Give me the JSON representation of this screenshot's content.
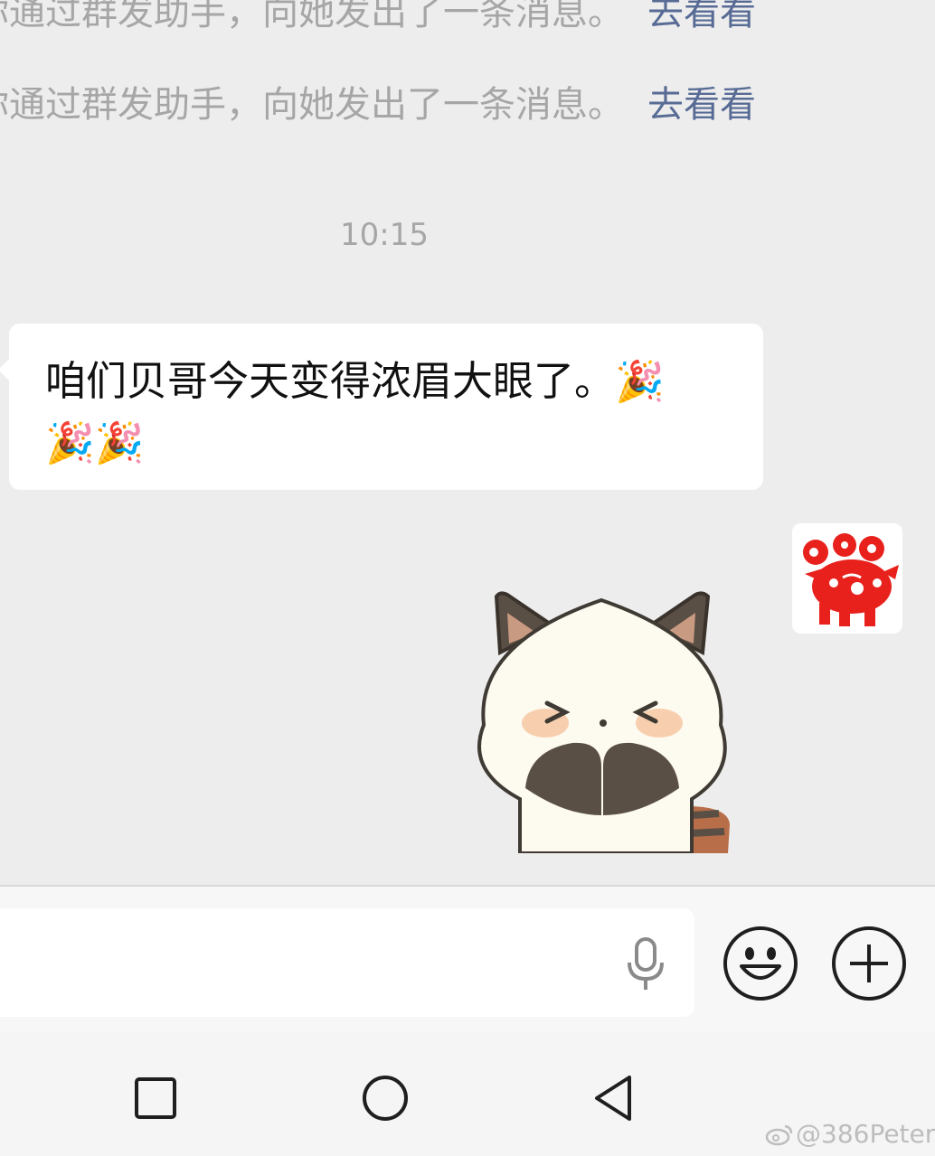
{
  "system_messages": [
    {
      "text": "你通过群发助手，向她发出了一条消息。",
      "link": "去看看"
    },
    {
      "text": "你通过群发助手，向她发出了一条消息。",
      "link": "去看看"
    }
  ],
  "timestamp": "10:15",
  "incoming_message": {
    "text": "咱们贝哥今天变得浓眉大眼了。",
    "emoji_line1": "🎉",
    "emoji_line2": "🎉🎉"
  },
  "input": {
    "value": "",
    "placeholder": ""
  },
  "watermark": "@386Peter",
  "icons": [
    "mic-icon",
    "emoji-icon",
    "plus-icon",
    "nav-square-icon",
    "nav-home-icon",
    "nav-back-icon",
    "weibo-icon"
  ],
  "colors": {
    "link": "#576b95",
    "chat_bg": "#ededed",
    "bubble": "#ffffff",
    "avatar_red": "#e8211c"
  }
}
